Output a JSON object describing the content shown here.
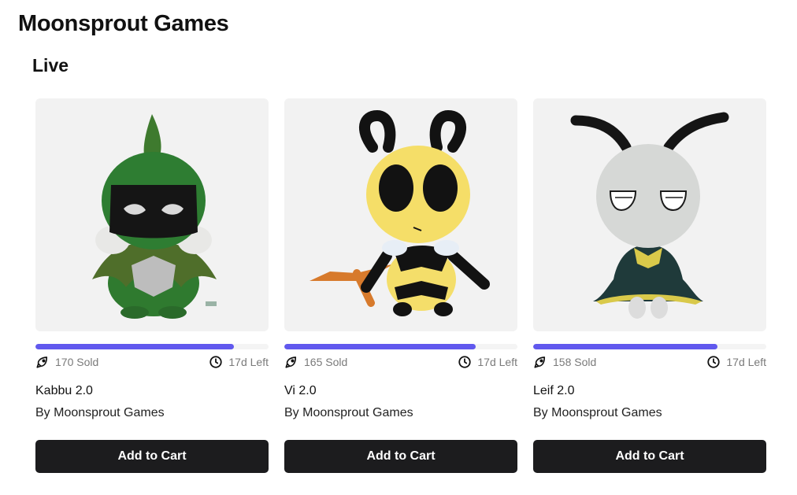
{
  "store": {
    "title": "Moonsprout Games"
  },
  "section": {
    "title": "Live"
  },
  "icons": {
    "sold": "rocket-icon",
    "time": "clock-icon"
  },
  "colors": {
    "progress": "#6159ee",
    "button_bg": "#1c1c1e",
    "card_bg": "#f2f2f2"
  },
  "products": [
    {
      "name": "Kabbu 2.0",
      "by": "By Moonsprout Games",
      "sold": "170 Sold",
      "left": "17d Left",
      "progress_fraction": 0.85,
      "button": "Add to Cart",
      "image": "green-beetle-plush"
    },
    {
      "name": "Vi 2.0",
      "by": "By Moonsprout Games",
      "sold": "165 Sold",
      "left": "17d Left",
      "progress_fraction": 0.82,
      "button": "Add to Cart",
      "image": "yellow-bee-plush"
    },
    {
      "name": "Leif 2.0",
      "by": "By Moonsprout Games",
      "sold": "158 Sold",
      "left": "17d Left",
      "progress_fraction": 0.79,
      "button": "Add to Cart",
      "image": "white-moth-plush"
    }
  ]
}
